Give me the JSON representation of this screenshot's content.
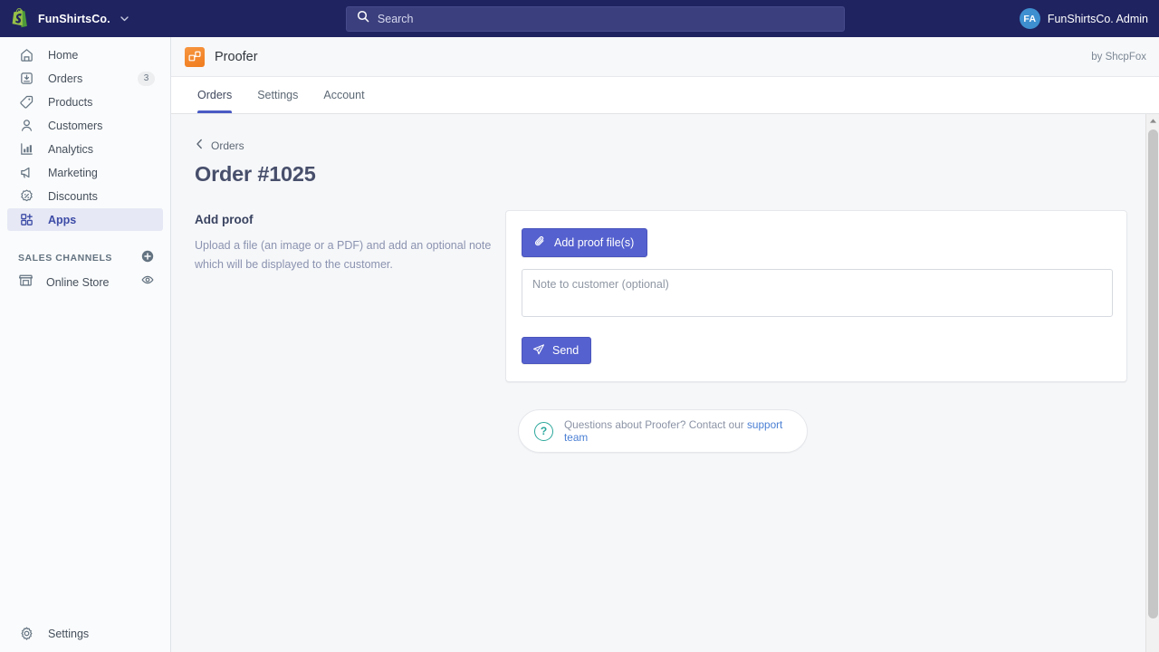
{
  "topbar": {
    "logo_icon": "shopify-bag-icon",
    "store_name": "FunShirtsCo.",
    "store_caret_icon": "chevron-down-icon",
    "search": {
      "icon": "search-icon",
      "placeholder": "Search",
      "value": ""
    },
    "user": {
      "avatar_initials": "FA",
      "name": "FunShirtsCo. Admin"
    }
  },
  "sidebar": {
    "items": [
      {
        "label": "Home",
        "icon": "home-icon",
        "badge": "",
        "active": false
      },
      {
        "label": "Orders",
        "icon": "orders-icon",
        "badge": "3",
        "active": false
      },
      {
        "label": "Products",
        "icon": "products-tag-icon",
        "badge": "",
        "active": false
      },
      {
        "label": "Customers",
        "icon": "customers-icon",
        "badge": "",
        "active": false
      },
      {
        "label": "Analytics",
        "icon": "analytics-bars-icon",
        "badge": "",
        "active": false
      },
      {
        "label": "Marketing",
        "icon": "marketing-megaphone-icon",
        "badge": "",
        "active": false
      },
      {
        "label": "Discounts",
        "icon": "discounts-percent-icon",
        "badge": "",
        "active": false
      },
      {
        "label": "Apps",
        "icon": "apps-grid-plus-icon",
        "badge": "",
        "active": true
      }
    ],
    "sales_channels": {
      "title": "SALES CHANNELS",
      "add_icon": "plus-circle-icon",
      "channels": [
        {
          "label": "Online Store",
          "icon": "store-icon",
          "action_icon": "eye-icon"
        }
      ]
    },
    "settings": {
      "label": "Settings",
      "icon": "gear-icon"
    }
  },
  "app_header": {
    "icon": "proofer-app-icon",
    "title": "Proofer",
    "author": "by ShcpFox"
  },
  "tabs": [
    {
      "label": "Orders",
      "active": true
    },
    {
      "label": "Settings",
      "active": false
    },
    {
      "label": "Account",
      "active": false
    }
  ],
  "main": {
    "breadcrumb": {
      "icon": "chevron-left-icon",
      "label": "Orders"
    },
    "page_title": "Order #1025",
    "add_proof": {
      "title": "Add proof",
      "description": "Upload a file (an image or a PDF) and add an optional note which will be displayed to the customer.",
      "upload_button": {
        "label": "Add proof file(s)",
        "icon": "paperclip-icon"
      },
      "note_placeholder": "Note to customer (optional)",
      "note_value": "",
      "send_button": {
        "label": "Send",
        "icon": "paper-plane-icon"
      }
    },
    "support": {
      "icon": "question-circle-icon",
      "text": "Questions about Proofer? Contact our",
      "link": "support team"
    }
  },
  "scrollbar": {
    "up_arrow_icon": "caret-up-icon"
  },
  "colors": {
    "topbar_bg": "#1f2360",
    "primary": "#5561ce",
    "app_accent": "#f0801f",
    "active_nav_bg": "#e6e8f5",
    "link": "#4a7fd4",
    "support_icon": "#2aa79b"
  }
}
